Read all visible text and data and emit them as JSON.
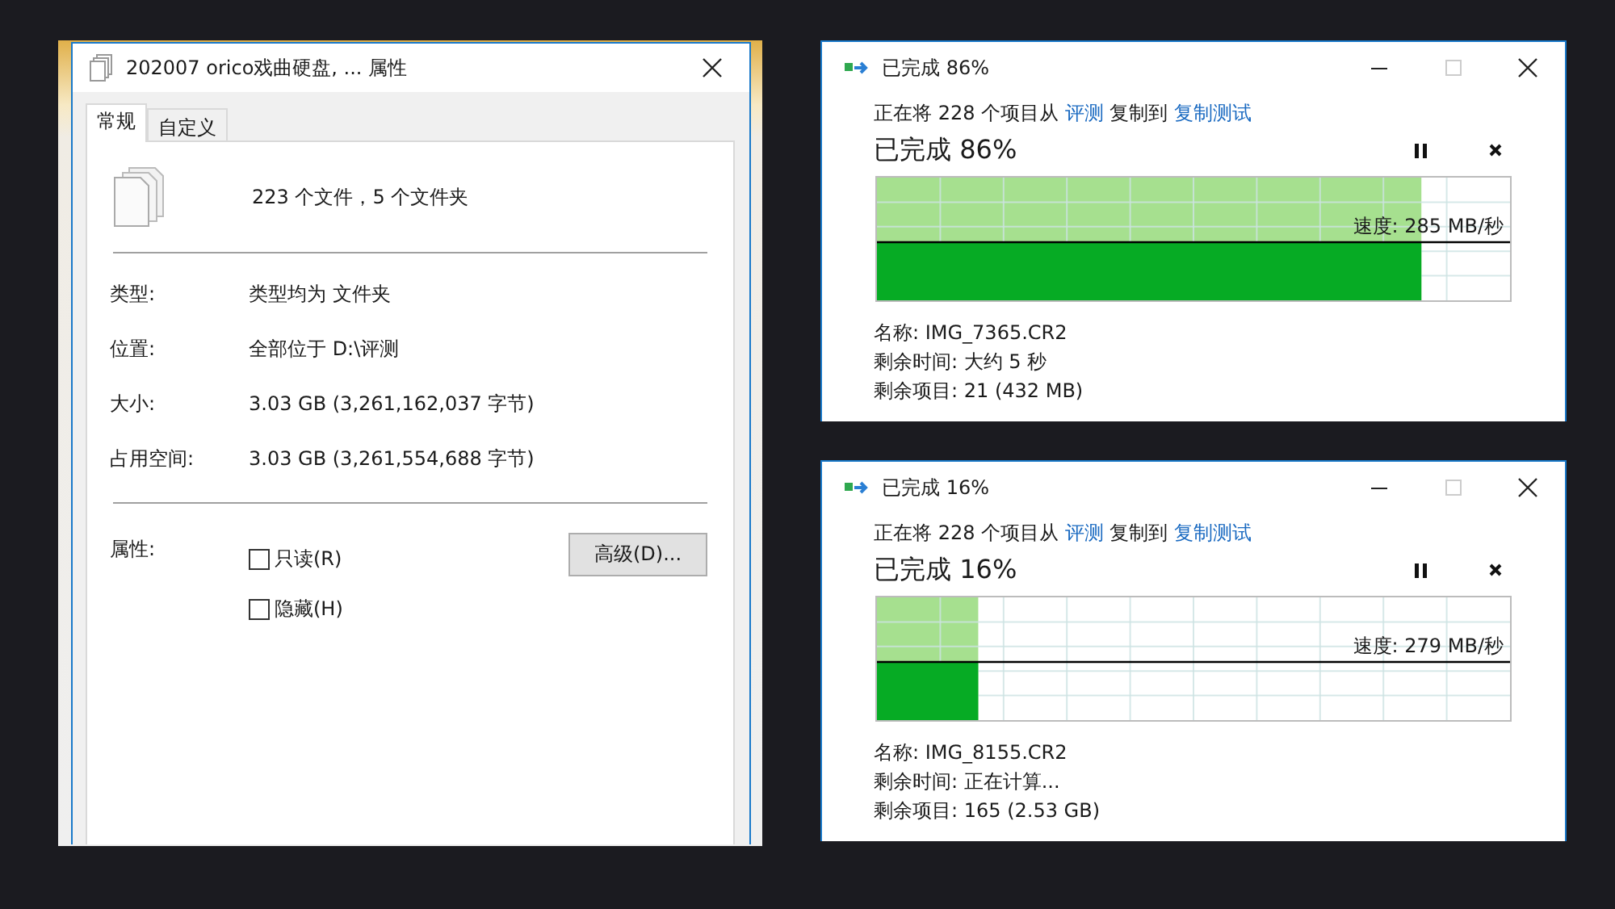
{
  "properties_window": {
    "title": "202007 orico戏曲硬盘, ... 属性",
    "tabs": [
      {
        "label": "常规",
        "selected": true
      },
      {
        "label": "自定义",
        "selected": false
      }
    ],
    "summary": "223 个文件，5 个文件夹",
    "rows": [
      {
        "label": "类型:",
        "value": "类型均为 文件夹"
      },
      {
        "label": "位置:",
        "value": "全部位于 D:\\评测"
      },
      {
        "label": "大小:",
        "value": "3.03 GB (3,261,162,037 字节)"
      },
      {
        "label": "占用空间:",
        "value": "3.03 GB (3,261,554,688 字节)"
      }
    ],
    "attributes_label": "属性:",
    "checkboxes": [
      {
        "label": "只读(R)",
        "checked": false
      },
      {
        "label": "隐藏(H)",
        "checked": false
      }
    ],
    "advanced_button": "高级(D)..."
  },
  "copy_dialogs": [
    {
      "title": "已完成 86%",
      "description": [
        {
          "kind": "text",
          "text": "正在将 228 个项目从"
        },
        {
          "kind": "link",
          "text": "评测"
        },
        {
          "kind": "text",
          "text": "复制到"
        },
        {
          "kind": "link",
          "text": "复制测试"
        }
      ],
      "heading": "已完成 86%",
      "level": 0.86,
      "speed": "速度: 285 MB/秒",
      "details": [
        "名称: IMG_7365.CR2",
        "剩余时间: 大约 5 秒",
        "剩余项目: 21 (432 MB)"
      ]
    },
    {
      "title": "已完成 16%",
      "description": [
        {
          "kind": "text",
          "text": "正在将 228 个项目从"
        },
        {
          "kind": "link",
          "text": "评测"
        },
        {
          "kind": "text",
          "text": "复制到"
        },
        {
          "kind": "link",
          "text": "复制测试"
        }
      ],
      "heading": "已完成 16%",
      "level": 0.16,
      "speed": "速度: 279 MB/秒",
      "details": [
        "名称: IMG_8155.CR2",
        "剩余时间: 正在计算...",
        "剩余项目: 165 (2.53 GB)"
      ]
    }
  ]
}
